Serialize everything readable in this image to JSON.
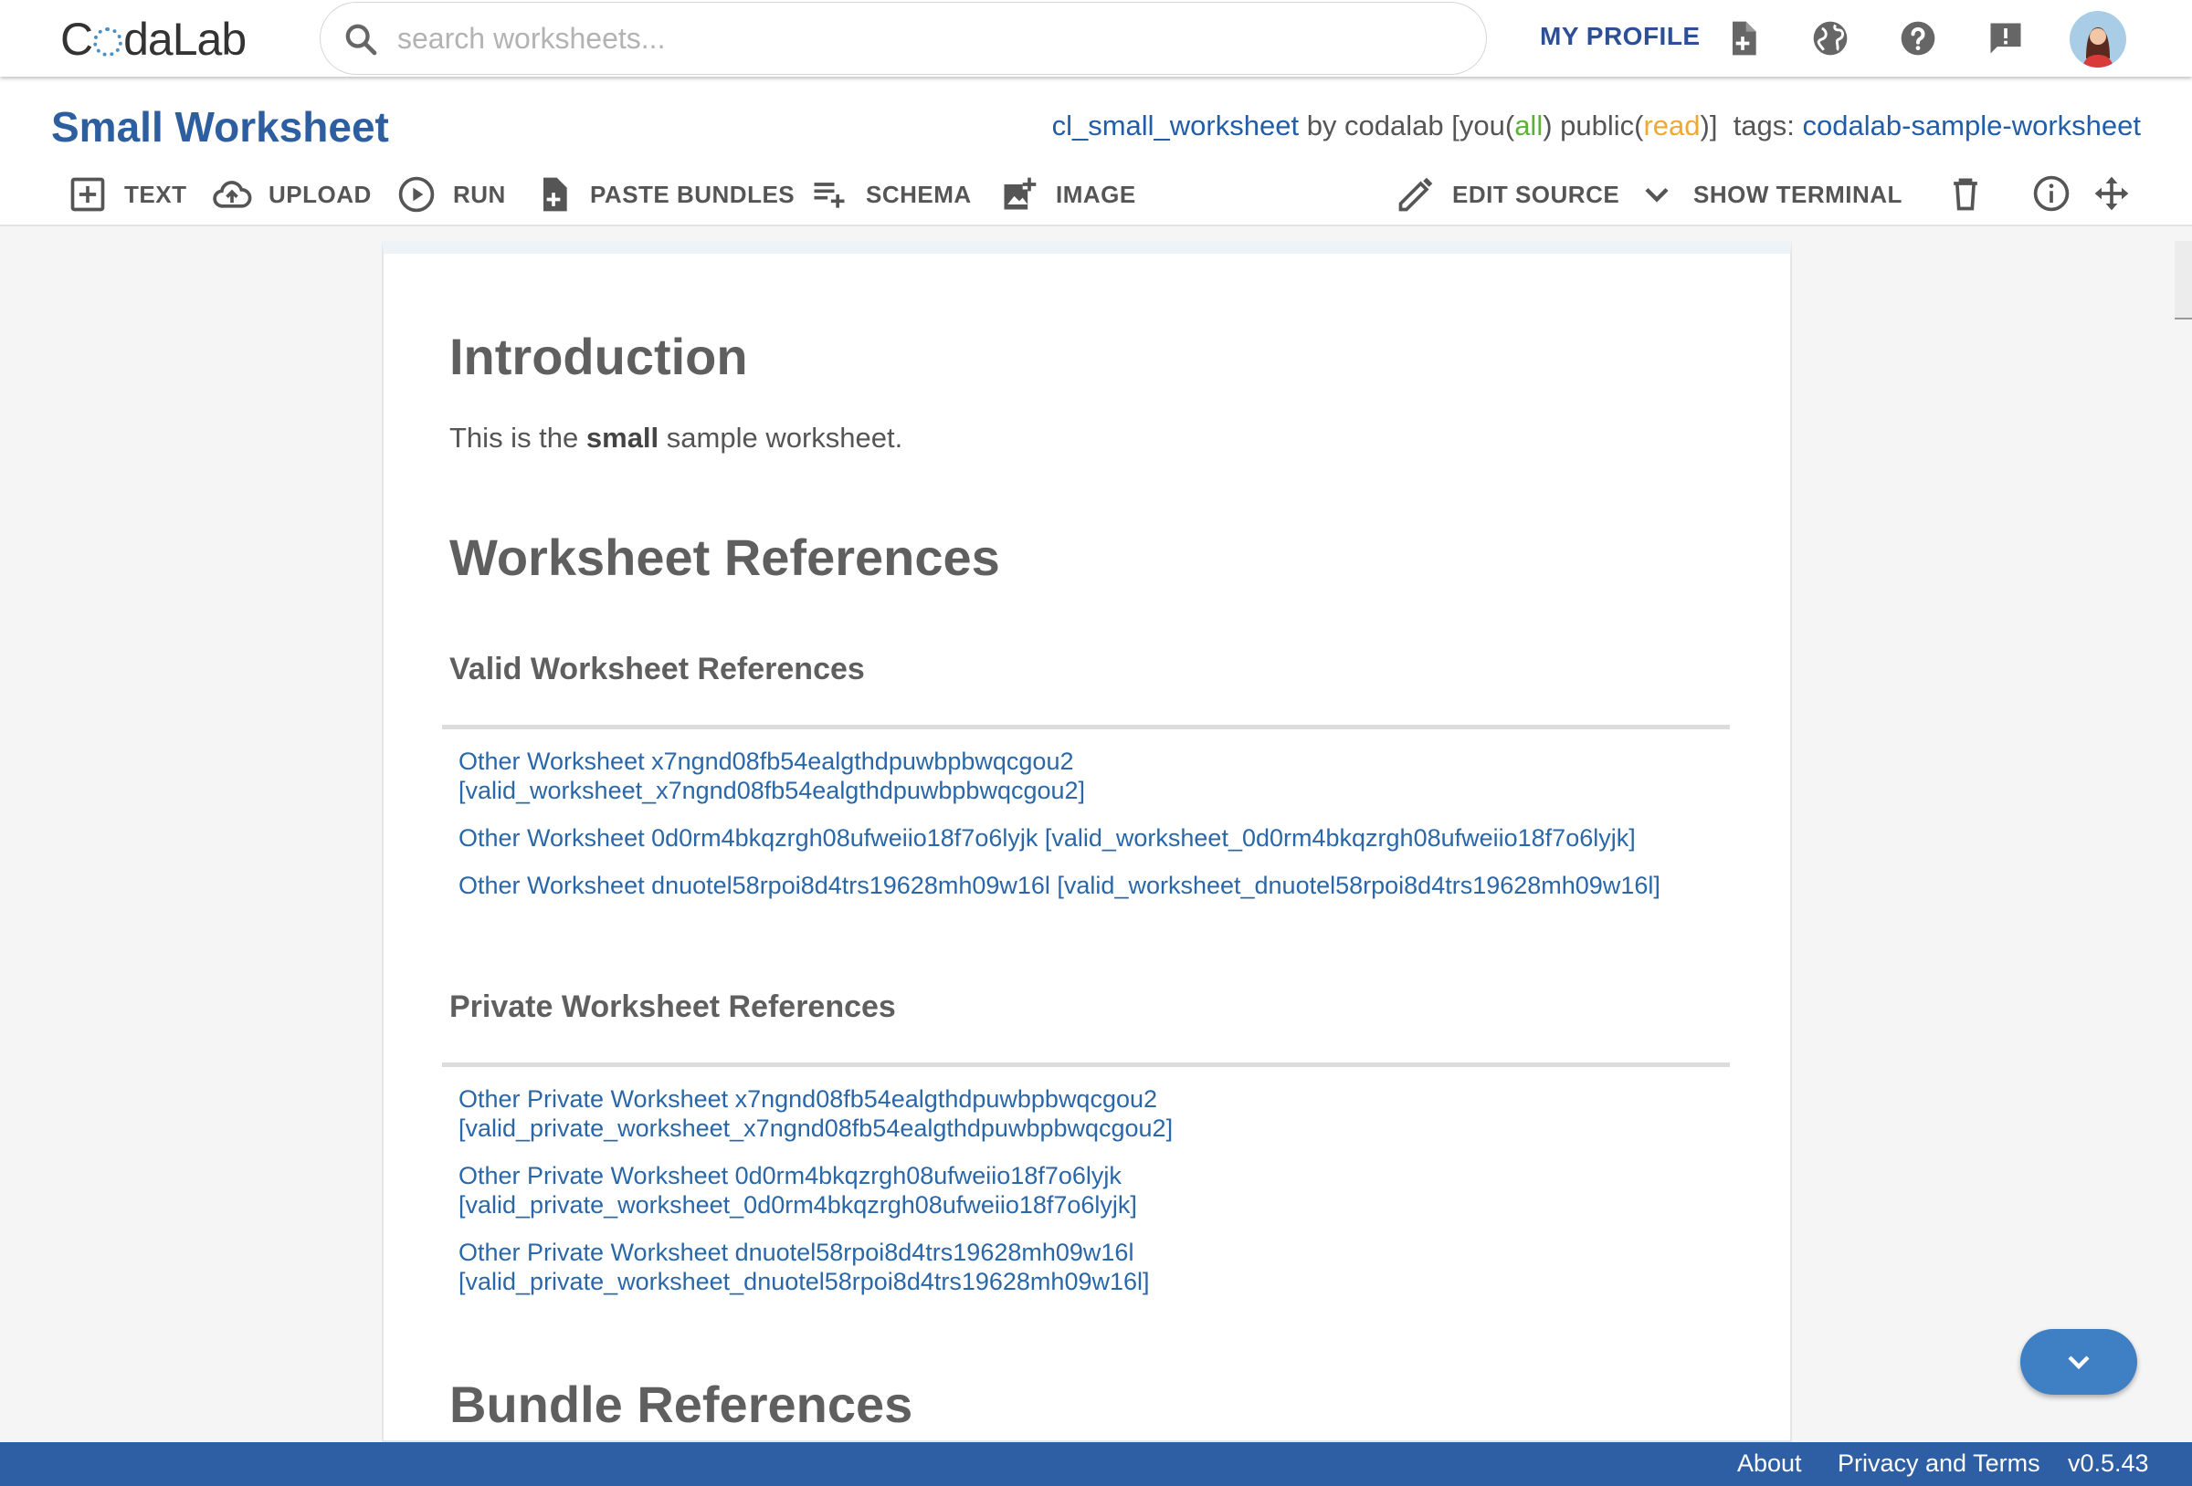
{
  "topnav": {
    "logo_text": "CodaLab",
    "search_placeholder": "search worksheets...",
    "my_profile": "MY PROFILE",
    "icons": [
      "new-worksheet-icon",
      "globe-icon",
      "help-icon",
      "feedback-icon",
      "avatar"
    ]
  },
  "worksheet": {
    "title": "Small Worksheet",
    "uuid_name": "cl_small_worksheet",
    "by_text": "by codalab",
    "perm_you": "[you(",
    "perm_all": "all",
    "perm_public": ") public(",
    "perm_read": "read",
    "perm_close": ")]",
    "tags_label": "tags:",
    "tag": "codalab-sample-worksheet"
  },
  "toolbar": {
    "text": "TEXT",
    "upload": "UPLOAD",
    "run": "RUN",
    "paste_bundles": "PASTE BUNDLES",
    "schema": "SCHEMA",
    "image": "IMAGE",
    "edit_source": "EDIT SOURCE",
    "show_terminal": "SHOW TERMINAL"
  },
  "content": {
    "intro_heading": "Introduction",
    "intro_pre": "This is the ",
    "intro_bold": "small",
    "intro_post": " sample worksheet.",
    "ws_refs_heading": "Worksheet References",
    "valid_heading": "Valid Worksheet References",
    "valid_links": [
      {
        "line1": "Other Worksheet x7ngnd08fb54ealgthdpuwbpbwqcgou2",
        "line2": "[valid_worksheet_x7ngnd08fb54ealgthdpuwbpbwqcgou2]"
      },
      {
        "line1": "Other Worksheet 0d0rm4bkqzrgh08ufweiio18f7o6lyjk [valid_worksheet_0d0rm4bkqzrgh08ufweiio18f7o6lyjk]"
      },
      {
        "line1": "Other Worksheet dnuotel58rpoi8d4trs19628mh09w16l [valid_worksheet_dnuotel58rpoi8d4trs19628mh09w16l]"
      }
    ],
    "private_heading": "Private Worksheet References",
    "private_links": [
      {
        "line1": "Other Private Worksheet x7ngnd08fb54ealgthdpuwbpbwqcgou2",
        "line2": "[valid_private_worksheet_x7ngnd08fb54ealgthdpuwbpbwqcgou2]"
      },
      {
        "line1": "Other Private Worksheet 0d0rm4bkqzrgh08ufweiio18f7o6lyjk",
        "line2": "[valid_private_worksheet_0d0rm4bkqzrgh08ufweiio18f7o6lyjk]"
      },
      {
        "line1": "Other Private Worksheet dnuotel58rpoi8d4trs19628mh09w16l",
        "line2": "[valid_private_worksheet_dnuotel58rpoi8d4trs19628mh09w16l]"
      }
    ],
    "bundle_refs_heading": "Bundle References"
  },
  "footer": {
    "about": "About",
    "privacy": "Privacy and Terms",
    "version": "v0.5.43"
  },
  "colors": {
    "brand_blue": "#2e5ea3",
    "link_blue": "#2a67a8",
    "perm_green": "#5bb336",
    "perm_orange": "#f0a830"
  }
}
